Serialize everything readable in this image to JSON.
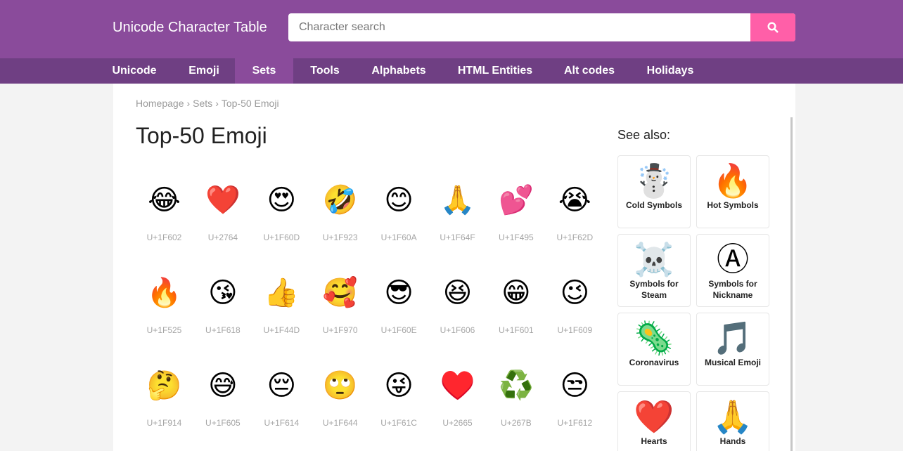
{
  "header": {
    "logo": "Unicode Character Table",
    "search_placeholder": "Character search"
  },
  "nav": [
    {
      "label": "Unicode"
    },
    {
      "label": "Emoji"
    },
    {
      "label": "Sets",
      "active": true
    },
    {
      "label": "Tools"
    },
    {
      "label": "Alphabets"
    },
    {
      "label": "HTML Entities"
    },
    {
      "label": "Alt codes"
    },
    {
      "label": "Holidays"
    }
  ],
  "breadcrumb": {
    "home": "Homepage",
    "sets": "Sets",
    "current": "Top-50 Emoji",
    "separator": "›"
  },
  "page_title": "Top-50 Emoji",
  "emojis": [
    {
      "char": "😂",
      "code": "U+1F602"
    },
    {
      "char": "❤️",
      "code": "U+2764"
    },
    {
      "char": "😍",
      "code": "U+1F60D"
    },
    {
      "char": "🤣",
      "code": "U+1F923"
    },
    {
      "char": "😊",
      "code": "U+1F60A"
    },
    {
      "char": "🙏",
      "code": "U+1F64F"
    },
    {
      "char": "💕",
      "code": "U+1F495"
    },
    {
      "char": "😭",
      "code": "U+1F62D"
    },
    {
      "char": "🔥",
      "code": "U+1F525"
    },
    {
      "char": "😘",
      "code": "U+1F618"
    },
    {
      "char": "👍",
      "code": "U+1F44D"
    },
    {
      "char": "🥰",
      "code": "U+1F970"
    },
    {
      "char": "😎",
      "code": "U+1F60E"
    },
    {
      "char": "😆",
      "code": "U+1F606"
    },
    {
      "char": "😁",
      "code": "U+1F601"
    },
    {
      "char": "😉",
      "code": "U+1F609"
    },
    {
      "char": "🤔",
      "code": "U+1F914"
    },
    {
      "char": "😅",
      "code": "U+1F605"
    },
    {
      "char": "😔",
      "code": "U+1F614"
    },
    {
      "char": "🙄",
      "code": "U+1F644"
    },
    {
      "char": "😜",
      "code": "U+1F61C"
    },
    {
      "char": "♥️",
      "code": "U+2665"
    },
    {
      "char": "♻️",
      "code": "U+267B"
    },
    {
      "char": "😒",
      "code": "U+1F612"
    }
  ],
  "see_also": {
    "title": "See also:",
    "items": [
      {
        "icon": "☃️",
        "label": "Cold Symbols"
      },
      {
        "icon": "🔥",
        "label": "Hot Symbols"
      },
      {
        "icon": "☠️",
        "label": "Symbols for Steam"
      },
      {
        "icon": "Ⓐ",
        "label": "Symbols for Nickname"
      },
      {
        "icon": "🦠",
        "label": "Coronavirus"
      },
      {
        "icon": "🎵",
        "label": "Musical Emoji"
      },
      {
        "icon": "❤️",
        "label": "Hearts"
      },
      {
        "icon": "🙏",
        "label": "Hands"
      }
    ]
  },
  "colors": {
    "header": "#8a4b9b",
    "nav": "#6f3f83",
    "search_button": "#ff5fa8"
  }
}
